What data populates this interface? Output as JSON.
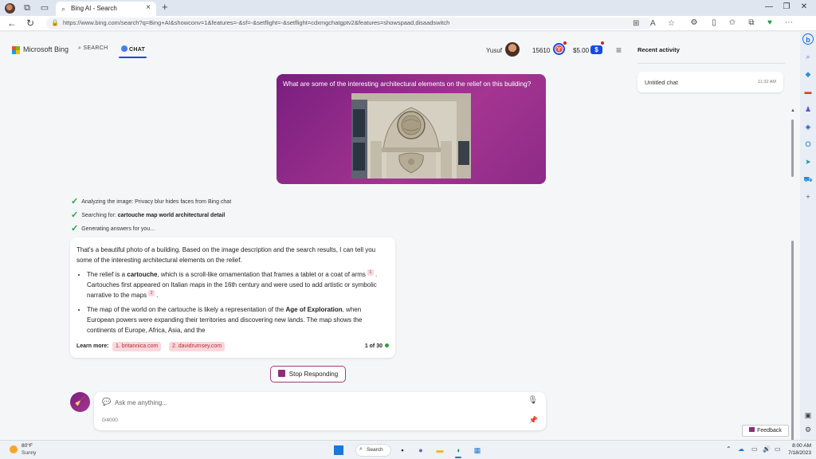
{
  "browser": {
    "tab_title": "Bing AI - Search",
    "url": "https://www.bing.com/search?q=Bing+AI&showconv=1&features=-&sf=-&setflight=-&setflight=cdxmgchatgptv2&features=showspaad,disaadswitch"
  },
  "header": {
    "brand": "Microsoft Bing",
    "nav_search": "SEARCH",
    "nav_chat": "CHAT",
    "user_name": "Yusuf",
    "points": "15610",
    "money": "$5.00"
  },
  "side_panel": {
    "title": "Recent activity",
    "history": [
      {
        "name": "Untitled chat",
        "time": "11:32 AM"
      }
    ]
  },
  "conversation": {
    "user_message": "What are some of the interesting architectural elements on the relief on this building?",
    "steps": [
      {
        "text": "Analyzing the image: Privacy blur hides faces from Bing chat",
        "bold": ""
      },
      {
        "text": "Searching for: ",
        "bold": "cartouche map world architectural detail"
      },
      {
        "text": "Generating answers for you…",
        "bold": ""
      }
    ],
    "answer": {
      "intro": "That's a beautiful photo of a building. Based on the image description and the search results, I can tell you some of the interesting architectural elements on the relief.",
      "bullet1_a": "The relief is a ",
      "bullet1_bold": "cartouche",
      "bullet1_b": ", which is a scroll-like ornamentation that frames a tablet or a coat of arms",
      "bullet1_cite1": "1",
      "bullet1_c": ". Cartouches first appeared on Italian maps in the 16th century and were used to add artistic or symbolic narrative to the maps",
      "bullet1_cite2": "2",
      "bullet1_d": ".",
      "bullet2_a": "The map of the world on the cartouche is likely a representation of the ",
      "bullet2_bold": "Age of Exploration",
      "bullet2_b": ", when European powers were expanding their territories and discovering new lands. The map shows the continents of Europe, Africa, Asia, and the",
      "learn_more": "Learn more:",
      "links": [
        "1. britannica.com",
        "2. davidrumsey.com"
      ],
      "pager": "1 of 30"
    },
    "stop_button": "Stop Responding",
    "input_placeholder": "Ask me anything...",
    "char_count": "0/4000"
  },
  "feedback": "Feedback",
  "taskbar": {
    "temp": "80°F",
    "weather": "Sunny",
    "search": "Search",
    "time": "8:00 AM",
    "date": "7/18/2023"
  },
  "colors": {
    "accent_blue": "#174ae4",
    "bubble_purple": "#a43591",
    "check_green": "#26a146",
    "cite_pink": "#f8d8dc"
  }
}
